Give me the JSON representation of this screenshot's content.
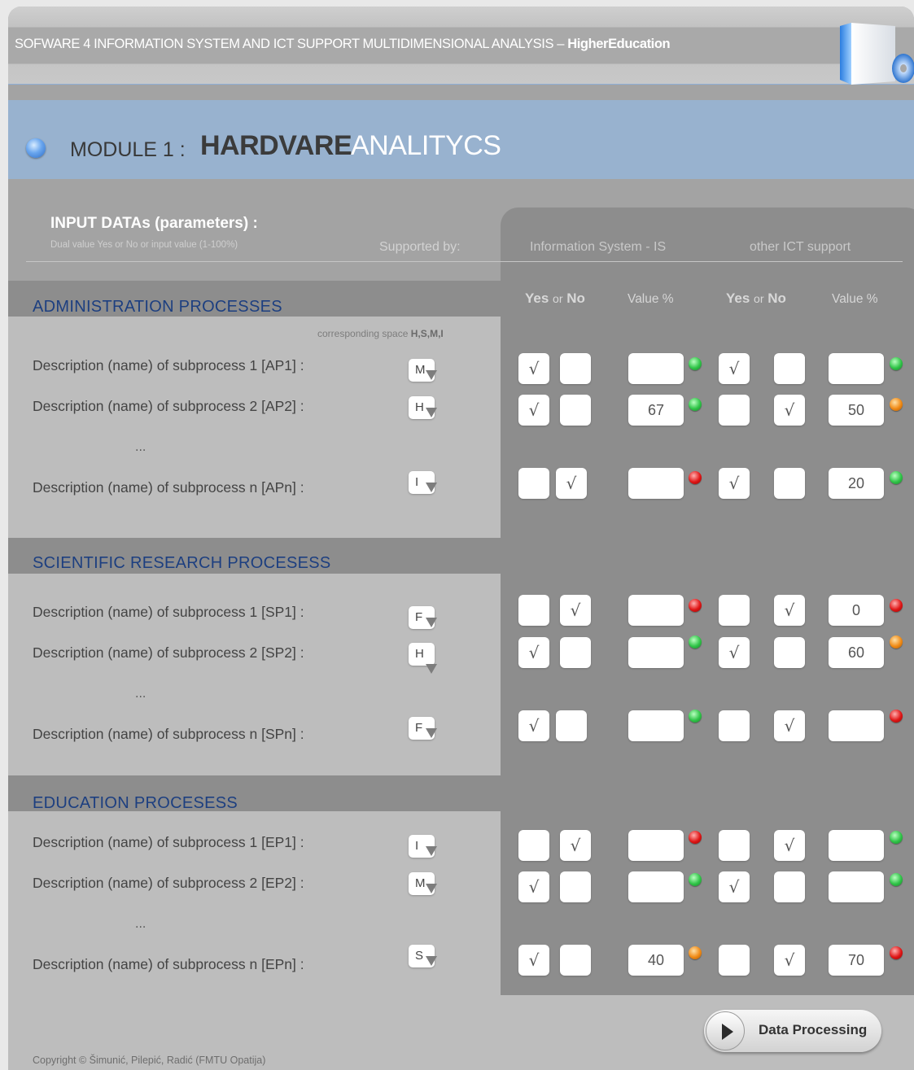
{
  "app": {
    "title_plain": "SOFWARE 4 INFORMATION SYSTEM AND ICT SUPPORT MULTIDIMENSIONAL ANALYSIS – ",
    "title_bold": "HigherEducation"
  },
  "module": {
    "prefix": "MODULE 1 :",
    "name_strong": "HARDVARE",
    "name_light": "ANALITYCS"
  },
  "input": {
    "title": "INPUT DATAs (parameters) :",
    "subtitle": "Dual value  Yes or No or input  value (1-100%)",
    "supported_by": "Supported by:",
    "col_is": "Information System - IS",
    "col_ict": "other ICT support"
  },
  "headers": {
    "yes": "Yes",
    "or": "or",
    "no": "No",
    "value": "Value %"
  },
  "corresponding": {
    "text": "corresponding space ",
    "letters": "H,S,M,I"
  },
  "colors": {
    "panel": "#a3a3a3",
    "module_bar": "#98b2cf",
    "section_title": "#1d3f80",
    "led_green": "#2fc447",
    "led_orange": "#f08a15",
    "led_red": "#e01616"
  },
  "sections": [
    {
      "title": "ADMINISTRATION PROCESSES",
      "ellipsis": "...",
      "rows": [
        {
          "label": "Description (name) of subprocess 1  [AP1] :",
          "space": "M",
          "is_yes": "√",
          "is_no": "",
          "is_value": "",
          "is_status": "green",
          "ict_yes": "√",
          "ict_no": "",
          "ict_value": "",
          "ict_status": "green"
        },
        {
          "label": "Description (name) of subprocess 2  [AP2] :",
          "space": "H",
          "is_yes": "√",
          "is_no": "",
          "is_value": "67",
          "is_status": "green",
          "ict_yes": "",
          "ict_no": "√",
          "ict_value": "50",
          "ict_status": "orange"
        },
        {
          "label": "Description (name) of subprocess n  [APn] :",
          "space": "I",
          "is_yes": "",
          "is_no": "√",
          "is_value": "",
          "is_status": "red",
          "ict_yes": "√",
          "ict_no": "",
          "ict_value": "20",
          "ict_status": "green"
        }
      ]
    },
    {
      "title": "SCIENTIFIC RESEARCH PROCESESS",
      "ellipsis": "...",
      "rows": [
        {
          "label": "Description (name) of subprocess 1  [SP1] :",
          "space": "F",
          "is_yes": "",
          "is_no": "√",
          "is_value": "",
          "is_status": "red",
          "ict_yes": "",
          "ict_no": "√",
          "ict_value": "0",
          "ict_status": "red"
        },
        {
          "label": "Description (name) of subprocess 2  [SP2] :",
          "space": "H",
          "is_yes": "√",
          "is_no": "",
          "is_value": "",
          "is_status": "green",
          "ict_yes": "√",
          "ict_no": "",
          "ict_value": "60",
          "ict_status": "orange"
        },
        {
          "label": "Description (name) of subprocess n  [SPn] :",
          "space": "F",
          "is_yes": "√",
          "is_no": "",
          "is_value": "",
          "is_status": "green",
          "ict_yes": "",
          "ict_no": "√",
          "ict_value": "",
          "ict_status": "red"
        }
      ]
    },
    {
      "title": "EDUCATION PROCESESS",
      "ellipsis": "...",
      "rows": [
        {
          "label": "Description (name) of subprocess 1  [EP1] :",
          "space": "I",
          "is_yes": "",
          "is_no": "√",
          "is_value": "",
          "is_status": "red",
          "ict_yes": "",
          "ict_no": "√",
          "ict_value": "",
          "ict_status": "green"
        },
        {
          "label": "Description (name) of subprocess 2  [EP2] :",
          "space": "M",
          "is_yes": "√",
          "is_no": "",
          "is_value": "",
          "is_status": "green",
          "ict_yes": "√",
          "ict_no": "",
          "ict_value": "",
          "ict_status": "green"
        },
        {
          "label": "Description (name) of subprocess n  [EPn] :",
          "space": "S",
          "is_yes": "√",
          "is_no": "",
          "is_value": "40",
          "is_status": "orange",
          "ict_yes": "",
          "ict_no": "√",
          "ict_value": "70",
          "ict_status": "red"
        }
      ]
    }
  ],
  "actions": {
    "process_label": "Data  Processing"
  },
  "footer": {
    "copyright": "Copyright  ©  Šimunić, Pilepić, Radić  (FMTU Opatija)"
  },
  "icons": {
    "module_bullet": "blue-dot-icon",
    "app_logo": "software-box-icon",
    "process": "play-icon"
  }
}
